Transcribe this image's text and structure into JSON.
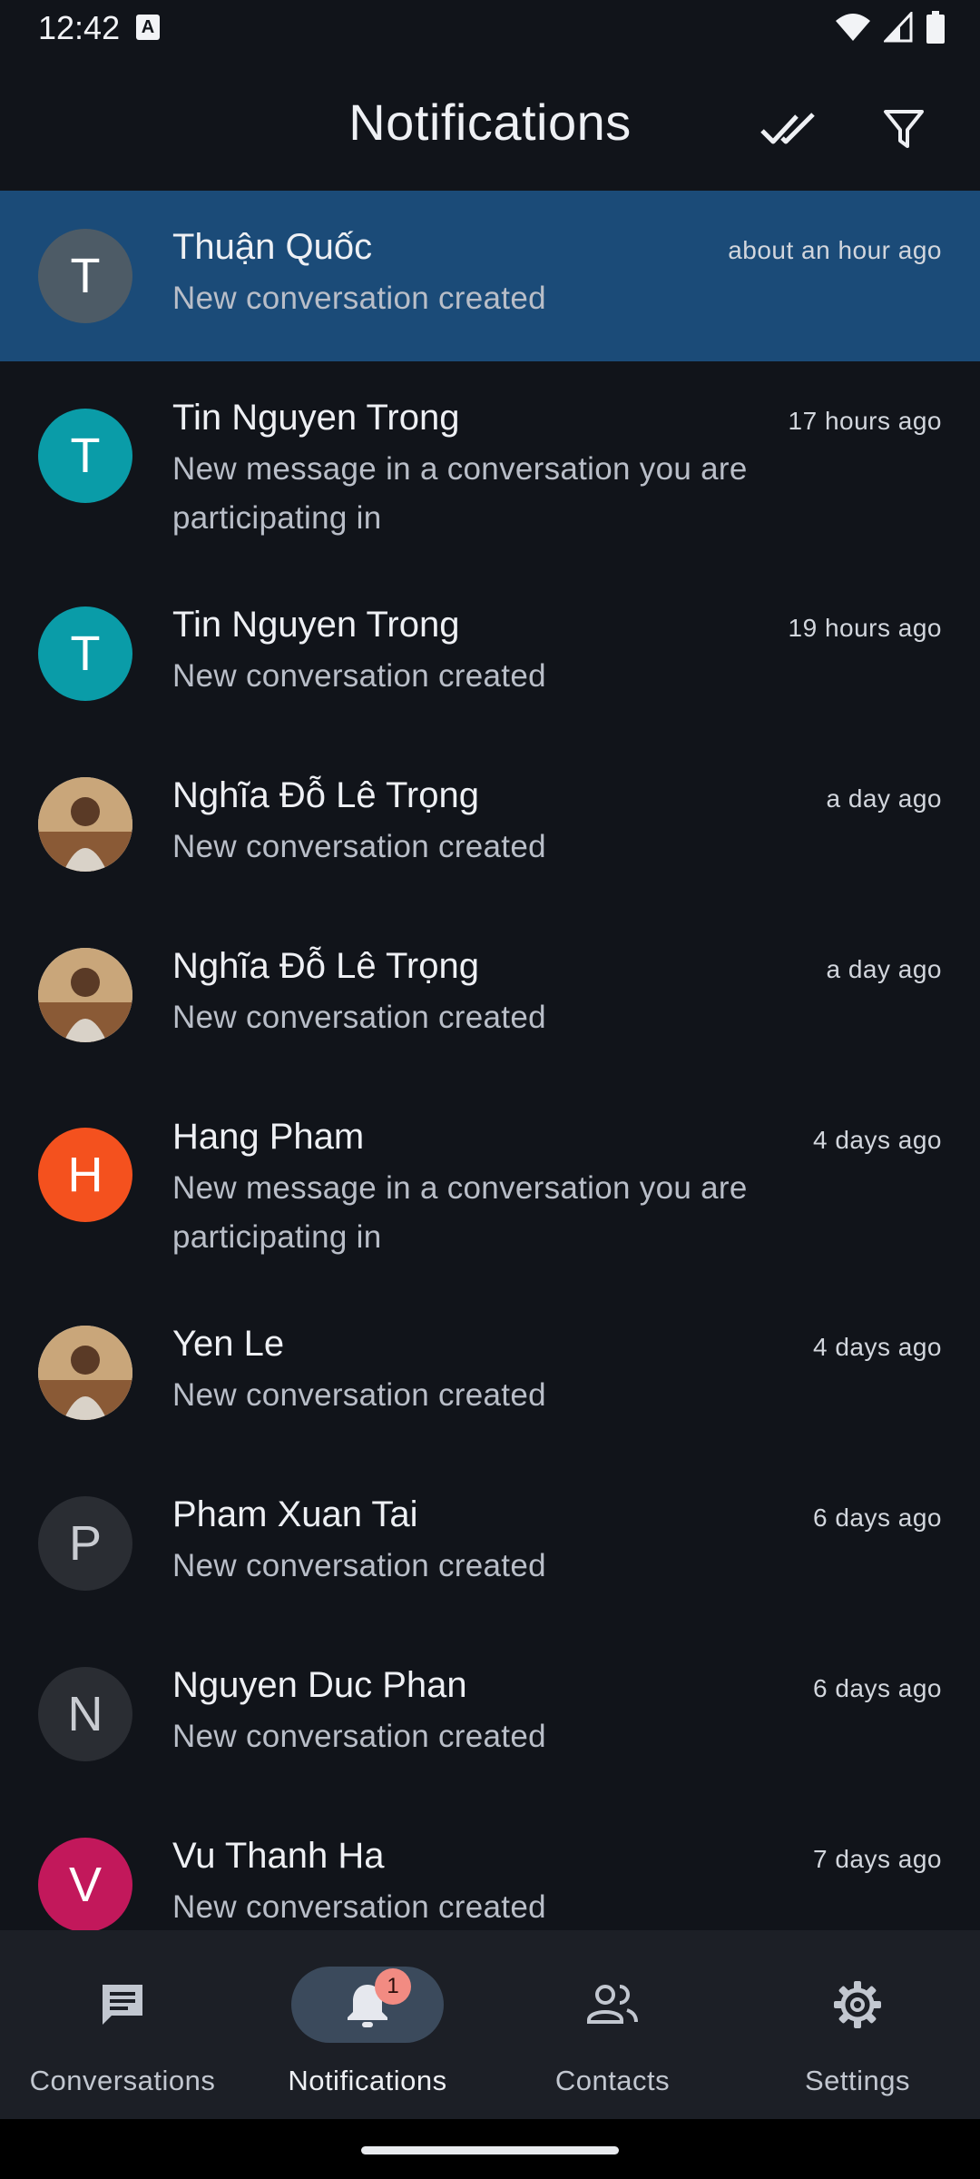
{
  "status_bar": {
    "time": "12:42",
    "a_icon": "A"
  },
  "app_bar": {
    "title": "Notifications",
    "actions": [
      "mark-all-read-icon",
      "filter-icon"
    ]
  },
  "notifications": [
    {
      "name": "Thuận Quốc",
      "time": "about an hour ago",
      "message": "New conversation created",
      "avatar_letter": "T",
      "avatar_color": "#4d5b66",
      "selected": true
    },
    {
      "name": "Tin Nguyen Trong",
      "time": "17 hours ago",
      "message": "New message in a conversation you are participating in",
      "avatar_letter": "T",
      "avatar_color": "#0a9ca8"
    },
    {
      "name": "Tin Nguyen Trong",
      "time": "19 hours ago",
      "message": "New conversation created",
      "avatar_letter": "T",
      "avatar_color": "#0a9ca8"
    },
    {
      "name": "Nghĩa Đỗ Lê Trọng",
      "time": "a day ago",
      "message": "New conversation created",
      "avatar_photo": true
    },
    {
      "name": "Nghĩa Đỗ Lê Trọng",
      "time": "a day ago",
      "message": "New conversation created",
      "avatar_photo": true
    },
    {
      "name": "Hang Pham",
      "time": "4 days ago",
      "message": "New message in a conversation you are participating in",
      "avatar_letter": "H",
      "avatar_color": "#f4511e"
    },
    {
      "name": "Yen Le",
      "time": "4 days ago",
      "message": "New conversation created",
      "avatar_photo": true
    },
    {
      "name": "Pham Xuan Tai",
      "time": "6 days ago",
      "message": "New conversation created",
      "avatar_letter": "P",
      "avatar_color": "#2a2d33"
    },
    {
      "name": "Nguyen Duc Phan",
      "time": "6 days ago",
      "message": "New conversation created",
      "avatar_letter": "N",
      "avatar_color": "#2a2d33"
    },
    {
      "name": "Vu Thanh Ha",
      "time": "7 days ago",
      "message": "New conversation created",
      "avatar_letter": "V",
      "avatar_color": "#c2185b"
    }
  ],
  "bottom_nav": {
    "items": [
      {
        "label": "Conversations",
        "icon": "chat-icon"
      },
      {
        "label": "Notifications",
        "icon": "bell-icon",
        "active": true,
        "badge": "1"
      },
      {
        "label": "Contacts",
        "icon": "people-icon"
      },
      {
        "label": "Settings",
        "icon": "gear-icon"
      }
    ]
  },
  "colors": {
    "background": "#11141a",
    "selected_row": "#1b4b78",
    "nav_background": "#1c1f26",
    "badge": "#f28b82"
  }
}
